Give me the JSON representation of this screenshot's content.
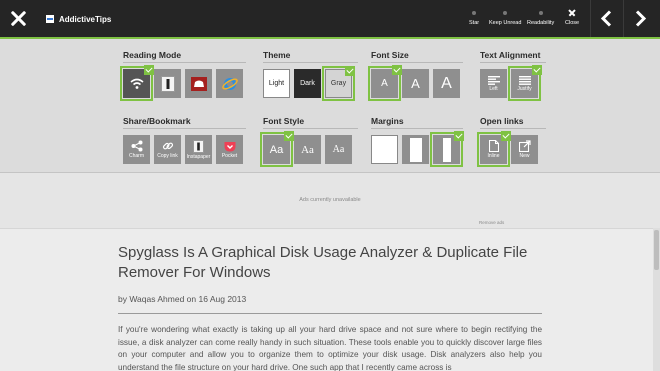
{
  "topbar": {
    "site_title": "AddictiveTips",
    "actions": [
      {
        "label": "Star"
      },
      {
        "label": "Keep Unread"
      },
      {
        "label": "Readability"
      },
      {
        "label": "Close"
      }
    ]
  },
  "panel": {
    "reading_mode": {
      "title": "Reading Mode"
    },
    "theme": {
      "title": "Theme",
      "light": "Light",
      "dark": "Dark",
      "gray": "Gray"
    },
    "font_size": {
      "title": "Font Size",
      "small": "A",
      "medium": "A",
      "large": "A"
    },
    "text_alignment": {
      "title": "Text Alignment",
      "left": "Left",
      "justify": "Justify"
    },
    "share": {
      "title": "Share/Bookmark",
      "charm": "Charm",
      "copy_link": "Copy link",
      "instapaper": "Instapaper",
      "pocket": "Pocket"
    },
    "font_style": {
      "title": "Font Style",
      "aa1": "Aa",
      "aa2": "Aa",
      "aa3": "Aa"
    },
    "margins": {
      "title": "Margins"
    },
    "open_links": {
      "title": "Open links",
      "inline": "Inline",
      "new": "New"
    }
  },
  "ads": {
    "unavailable": "Ads currently unavailable",
    "remove": "Remove ads"
  },
  "article": {
    "title": "Spyglass Is A Graphical Disk Usage Analyzer & Duplicate File Remover For Windows",
    "byline": "by Waqas Ahmed on 16 Aug 2013",
    "body": "If you're wondering what exactly is taking up all your hard drive space and not sure where to begin rectifying the issue, a disk analyzer can come really handy in such situation. These tools enable you to quickly discover large files on your computer and allow you to organize them to optimize your disk usage. Disk analyzers also help you understand the file structure on your hard drive. One such app that I recently came across is"
  },
  "colors": {
    "accent": "#7fc243",
    "topbar": "#252525",
    "tile": "#8f8f8f"
  }
}
